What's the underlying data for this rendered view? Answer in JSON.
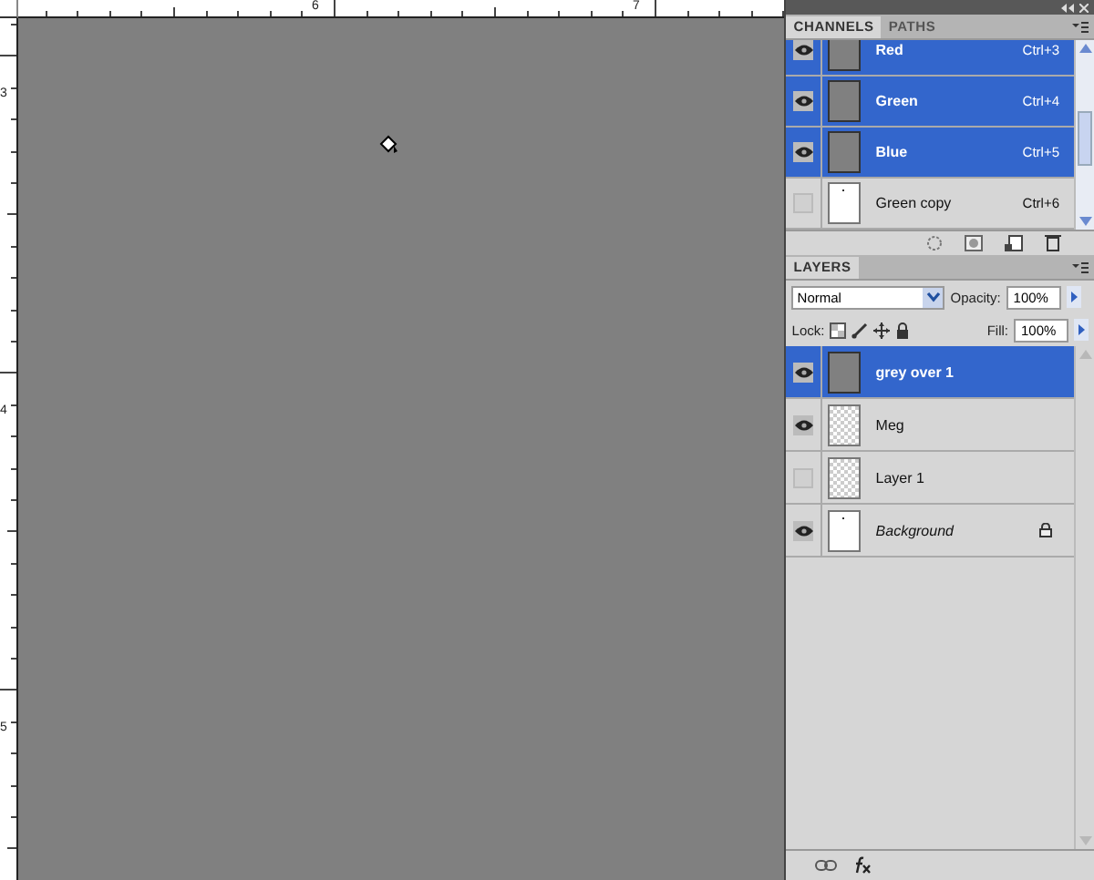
{
  "rulers": {
    "top_labels": [
      "6",
      "7"
    ],
    "left_labels": [
      "3",
      "4",
      "5"
    ]
  },
  "channels_panel": {
    "tabs": [
      {
        "label": "CHANNELS",
        "selected": true
      },
      {
        "label": "PATHS",
        "selected": false
      }
    ],
    "channels": [
      {
        "name": "Red",
        "shortcut": "Ctrl+3",
        "visible": true,
        "selected": true,
        "kind": "grey"
      },
      {
        "name": "Green",
        "shortcut": "Ctrl+4",
        "visible": true,
        "selected": true,
        "kind": "grey"
      },
      {
        "name": "Blue",
        "shortcut": "Ctrl+5",
        "visible": true,
        "selected": true,
        "kind": "grey"
      },
      {
        "name": "Green copy",
        "shortcut": "Ctrl+6",
        "visible": false,
        "selected": false,
        "kind": "white"
      }
    ]
  },
  "layers_panel": {
    "tabs": [
      {
        "label": "LAYERS",
        "selected": true
      }
    ],
    "blend_mode": "Normal",
    "opacity_label": "Opacity:",
    "opacity": "100%",
    "lock_label": "Lock:",
    "fill_label": "Fill:",
    "fill": "100%",
    "layers": [
      {
        "name": "grey over 1",
        "visible": true,
        "selected": true,
        "kind": "grey",
        "locked": false,
        "italic": false
      },
      {
        "name": "Meg",
        "visible": true,
        "selected": false,
        "kind": "transparent",
        "locked": false,
        "italic": false
      },
      {
        "name": "Layer 1",
        "visible": false,
        "selected": false,
        "kind": "transparent",
        "locked": false,
        "italic": false
      },
      {
        "name": "Background",
        "visible": true,
        "selected": false,
        "kind": "white",
        "locked": true,
        "italic": true
      }
    ]
  }
}
